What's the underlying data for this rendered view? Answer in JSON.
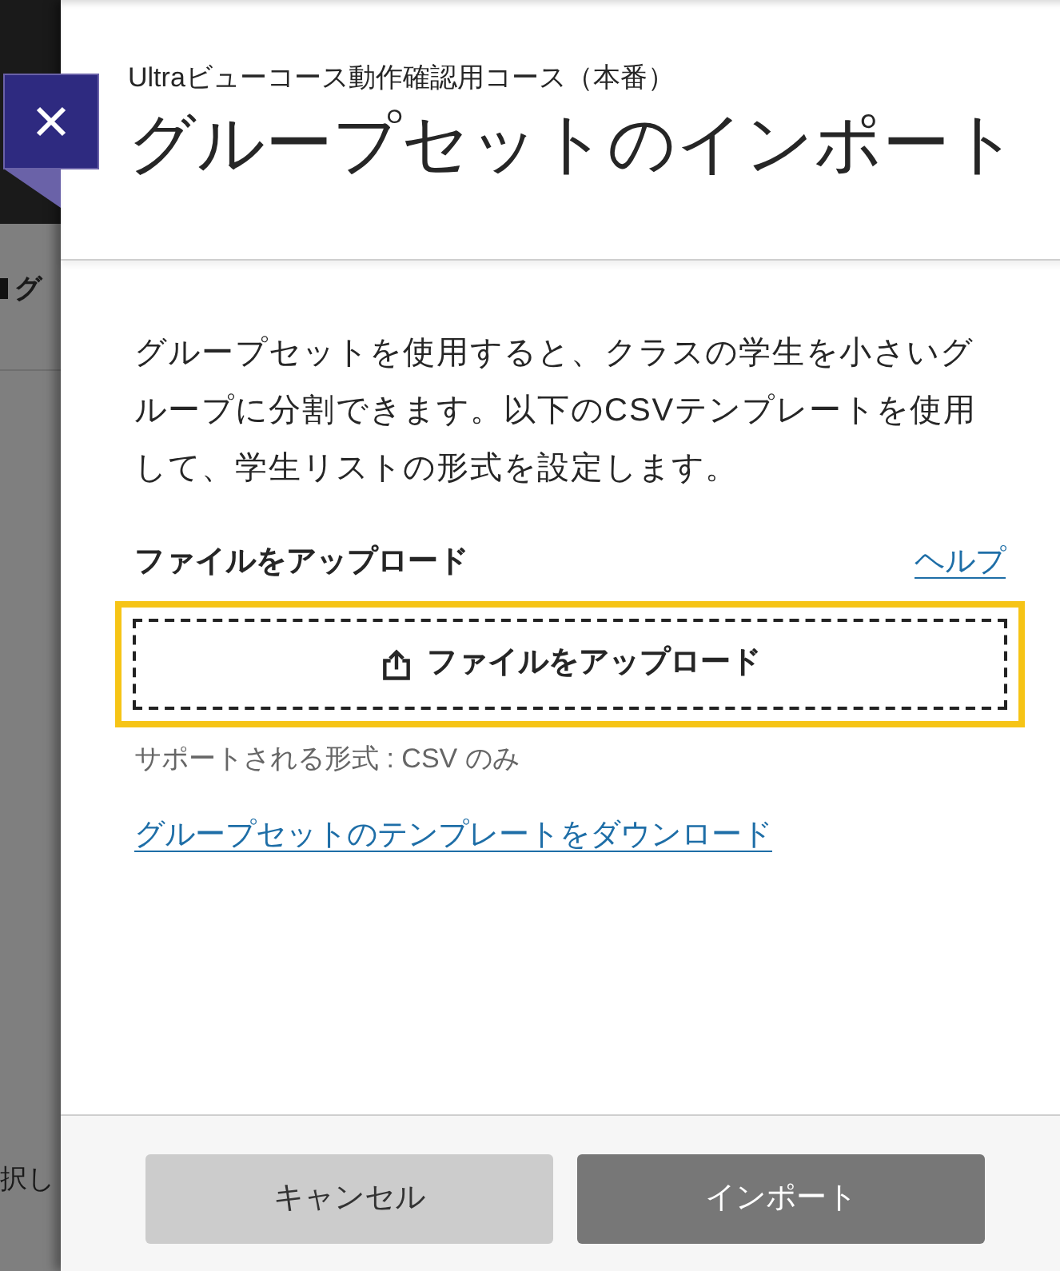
{
  "backdrop": {
    "heading": "グ",
    "text": "択し"
  },
  "dialog": {
    "course_name": "Ultraビューコース動作確認用コース（本番）",
    "title": "グループセットのインポート",
    "description": "グループセットを使用すると、クラスの学生を小さいグループに分割できます。以下のCSVテンプレートを使用して、学生リストの形式を設定します。",
    "upload": {
      "label": "ファイルをアップロード",
      "help_link": "ヘルプ",
      "button": "ファイルをアップロード",
      "focused": true,
      "note": "サポートされる形式 : CSV のみ"
    },
    "template_link": "グループセットのテンプレートをダウンロード",
    "buttons": [
      {
        "label": "キャンセル",
        "kind": "secondary"
      },
      {
        "label": "インポート",
        "kind": "primary"
      }
    ]
  }
}
